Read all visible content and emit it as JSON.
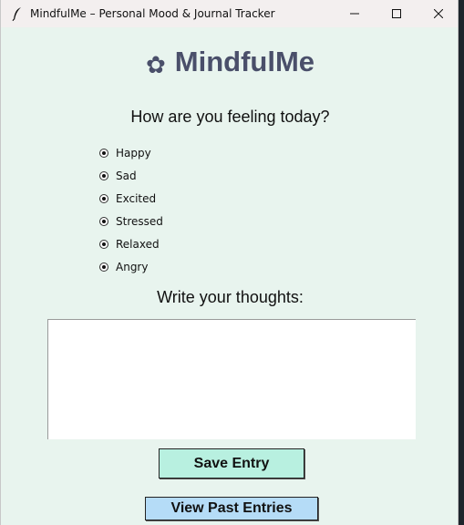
{
  "window": {
    "title": "MindfulMe – Personal Mood & Journal Tracker",
    "controls": [
      "minimize",
      "maximize",
      "close"
    ]
  },
  "header": {
    "icon": "flower-icon",
    "title": "MindfulMe"
  },
  "mood": {
    "question": "How are you feeling today?",
    "options": [
      "Happy",
      "Sad",
      "Excited",
      "Stressed",
      "Relaxed",
      "Angry"
    ]
  },
  "journal": {
    "label": "Write your thoughts:",
    "value": ""
  },
  "buttons": {
    "save_label": "Save Entry",
    "view_label": "View Past Entries"
  },
  "colors": {
    "background": "#e8f4ee",
    "title_color": "#4a4f6a",
    "save_button": "#b8f0e0",
    "view_button": "#b5dcf7"
  }
}
